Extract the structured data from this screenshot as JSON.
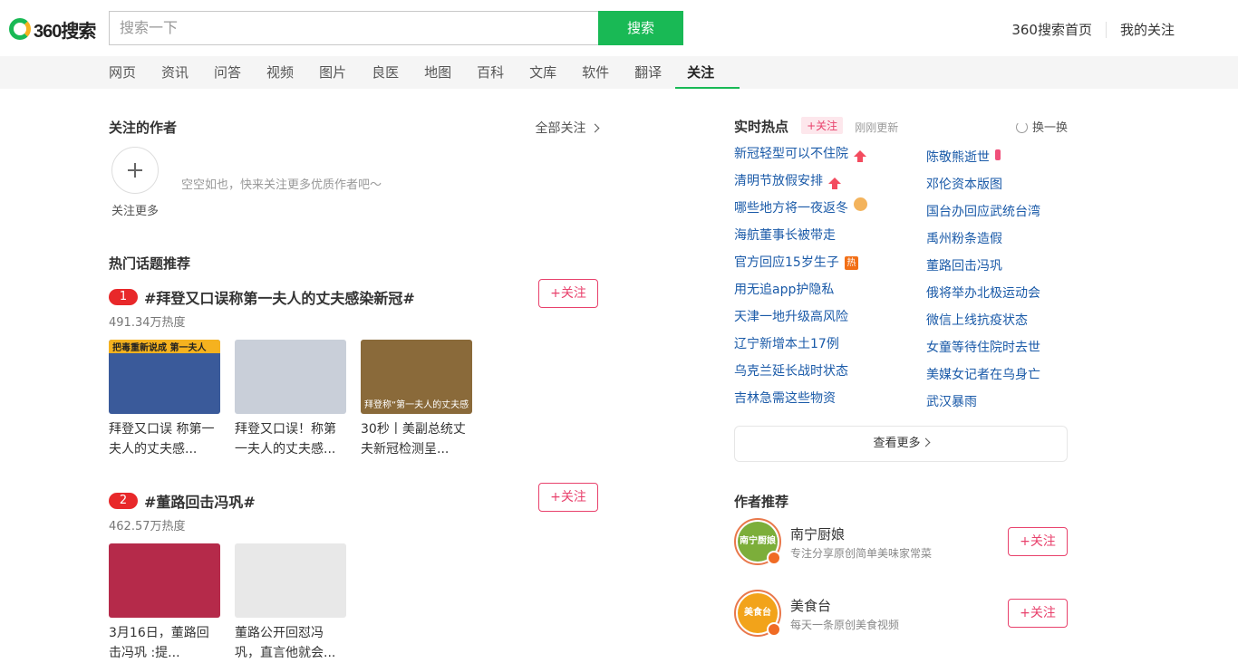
{
  "header": {
    "logo_text": "360搜索",
    "search_placeholder": "搜索一下",
    "search_button": "搜索",
    "links": [
      "360搜索首页",
      "我的关注"
    ]
  },
  "nav": {
    "items": [
      "网页",
      "资讯",
      "问答",
      "视频",
      "图片",
      "良医",
      "地图",
      "百科",
      "文库",
      "软件",
      "翻译",
      "关注"
    ],
    "active": "关注"
  },
  "followed_authors": {
    "title": "关注的作者",
    "all_follow": "全部关注",
    "follow_more": "关注更多",
    "empty_tip": "空空如也，快来关注更多优质作者吧～"
  },
  "hot_topics": {
    "title": "热门话题推荐",
    "topics": [
      {
        "rank": "1",
        "title": "#拜登又口误称第一夫人的丈夫感染新冠#",
        "heat": "491.34万热度",
        "follow": "+关注",
        "thumbs": [
          {
            "caption": "拜登又口误 称第一夫人的丈夫感...",
            "img_text": "把毒重新说成  第一夫人",
            "color": "#3a5a9a"
          },
          {
            "caption": "拜登又口误！称第一夫人的丈夫感...",
            "img_text": "",
            "color": "#c9cfd9"
          },
          {
            "caption": "30秒丨美副总统丈夫新冠检测呈...",
            "img_text": "拜登称“第一夫人的丈夫感",
            "color": "#8a6a3a"
          }
        ]
      },
      {
        "rank": "2",
        "title": "#董路回击冯巩#",
        "heat": "462.57万热度",
        "follow": "+关注",
        "thumbs": [
          {
            "caption": "3月16日，董路回击冯巩 :提...",
            "img_text": "",
            "color": "#b52a4a"
          },
          {
            "caption": "董路公开回怼冯巩，直言他就会...",
            "img_text": "",
            "color": "#e8e8e8"
          }
        ]
      }
    ]
  },
  "realtime_hot": {
    "title": "实时热点",
    "follow": "+关注",
    "updated": "刚刚更新",
    "refresh": "换一换",
    "left": [
      {
        "text": "新冠轻型可以不住院",
        "tag": "up"
      },
      {
        "text": "清明节放假安排",
        "tag": "up"
      },
      {
        "text": "哪些地方将一夜返冬",
        "tag": "palette"
      },
      {
        "text": "海航董事长被带走",
        "tag": ""
      },
      {
        "text": "官方回应15岁生子",
        "tag": "hot"
      },
      {
        "text": "用无追app护隐私",
        "tag": ""
      },
      {
        "text": "天津一地升级高风险",
        "tag": ""
      },
      {
        "text": "辽宁新增本土17例",
        "tag": ""
      },
      {
        "text": "乌克兰延长战时状态",
        "tag": ""
      },
      {
        "text": "吉林急需这些物资",
        "tag": ""
      }
    ],
    "right": [
      {
        "text": "陈敬熊逝世",
        "tag": "candle"
      },
      {
        "text": "邓伦资本版图",
        "tag": ""
      },
      {
        "text": "国台办回应武统台湾",
        "tag": ""
      },
      {
        "text": "禹州粉条造假",
        "tag": ""
      },
      {
        "text": "董路回击冯巩",
        "tag": ""
      },
      {
        "text": "俄将举办北极运动会",
        "tag": ""
      },
      {
        "text": "微信上线抗疫状态",
        "tag": ""
      },
      {
        "text": "女童等待住院时去世",
        "tag": ""
      },
      {
        "text": "美媒女记者在乌身亡",
        "tag": ""
      },
      {
        "text": "武汉暴雨",
        "tag": ""
      }
    ],
    "hot_tag_text": "热",
    "see_more": "查看更多"
  },
  "author_recommend": {
    "title": "作者推荐",
    "authors": [
      {
        "name": "南宁厨娘",
        "desc": "专注分享原创简单美味家常菜",
        "avatar_text": "南宁厨娘",
        "avatar_color": "#7cae3a",
        "follow": "+关注"
      },
      {
        "name": "美食台",
        "desc": "每天一条原创美食视频",
        "avatar_text": "美食台",
        "avatar_color": "#f2a31a",
        "follow": "+关注"
      }
    ]
  },
  "colors": {
    "brand_green": "#19b955",
    "follow_pink": "#e8416c",
    "rank_red": "#e8282a",
    "link_blue": "#1a5aa8"
  }
}
